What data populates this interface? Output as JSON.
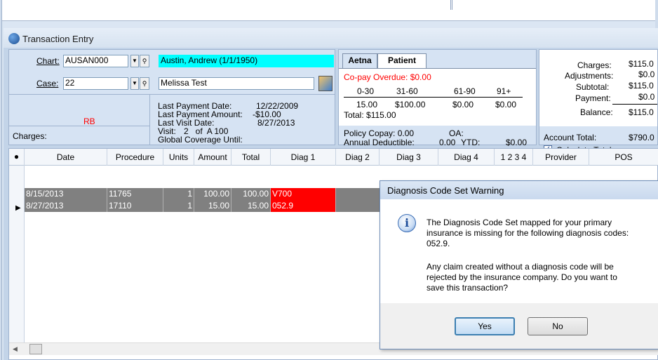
{
  "window": {
    "title": "Transaction Entry"
  },
  "chart": {
    "label": "Chart:",
    "value": "AUSAN000",
    "patient_name": "Austin, Andrew  (1/1/1950)"
  },
  "case": {
    "label": "Case:",
    "value": "22",
    "description": "Melissa Test"
  },
  "info": {
    "rb": "RB",
    "charges_label": "Charges:",
    "last_payment_date_label": "Last Payment Date:",
    "last_payment_date": "12/22/2009",
    "last_payment_amount_label": "Last Payment Amount:",
    "last_payment_amount": "-$10.00",
    "last_visit_date_label": "Last Visit Date:",
    "last_visit_date": "8/27/2013",
    "visit_label": "Visit:",
    "visit_value": "2   of  A 100",
    "global_coverage_label": "Global Coverage Until:"
  },
  "aging": {
    "tabs": [
      "Aetna",
      "Patient"
    ],
    "copay_overdue": "Co-pay Overdue: $0.00",
    "headers": [
      "0-30",
      "31-60",
      "61-90",
      "91+"
    ],
    "values": [
      "15.00",
      "$100.00",
      "$0.00",
      "$0.00"
    ],
    "total": "Total: $115.00",
    "policy_copay": "Policy Copay: 0.00",
    "oa": "OA:",
    "annual_deductible_label": "Annual Deductible:",
    "annual_deductible_value": "0.00",
    "ytd_label": "YTD:",
    "ytd_value": "$0.00"
  },
  "totals": {
    "charges_label": "Charges:",
    "charges": "$115.0",
    "adjustments_label": "Adjustments:",
    "adjustments": "$0.0",
    "subtotal_label": "Subtotal:",
    "subtotal": "$115.0",
    "payment_label": "Payment:",
    "payment": "$0.0",
    "balance_label": "Balance:",
    "balance": "$115.0",
    "account_total_label": "Account Total:",
    "account_total": "$790.0",
    "calculate_totals_label": "Calculate Totals",
    "calculate_totals_checked": true
  },
  "grid": {
    "columns": [
      "Date",
      "Procedure",
      "Units",
      "Amount",
      "Total",
      "Diag 1",
      "Diag 2",
      "Diag 3",
      "Diag 4",
      "1 2 3 4",
      "Provider",
      "POS"
    ],
    "rows": [
      {
        "date": "8/15/2013",
        "procedure": "11765",
        "units": "1",
        "amount": "100.00",
        "total": "100.00",
        "diag1": "V700"
      },
      {
        "date": "8/27/2013",
        "procedure": "17110",
        "units": "1",
        "amount": "15.00",
        "total": "15.00",
        "diag1": "052.9"
      }
    ]
  },
  "dialog": {
    "title": "Diagnosis Code Set Warning",
    "message_line1": "The Diagnosis Code Set mapped for your primary",
    "message_line2": "insurance is missing for the following diagnosis codes:",
    "message_line3": "052.9.",
    "message_line4": "Any claim created without a diagnosis code will be",
    "message_line5": "rejected by the insurance company.  Do you want to",
    "message_line6": "save this transaction?",
    "yes_label": "Yes",
    "no_label": "No"
  },
  "colors": {
    "selected_row": "#808080",
    "diag_highlight": "#ff0000",
    "name_highlight": "#00ffff",
    "warning_text": "#ff0000"
  }
}
